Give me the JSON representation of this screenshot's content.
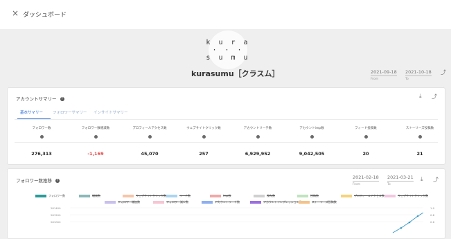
{
  "header": {
    "close_icon": "close-icon",
    "close_glyph": "×",
    "title": "ダッシュボード"
  },
  "profile": {
    "logo_text": "k u r a\n· · ·\ns u m u",
    "name": "kurasumu［クラスム］",
    "date_from": "2021-09-18",
    "date_from_label": "From",
    "date_to": "2021-10-18",
    "date_to_label": "To"
  },
  "summary": {
    "title": "アカウントサマリー",
    "tabs": [
      "基本サマリー",
      "フォロワーサマリー",
      "インサイトサマリー"
    ],
    "active_tab": 0,
    "columns": [
      {
        "label": "フォロワー数",
        "value": "276,313",
        "negative": false
      },
      {
        "label": "フォロワー数増減数",
        "value": "-1,169",
        "negative": true
      },
      {
        "label": "プロフィールアクセス数",
        "value": "45,070",
        "negative": false
      },
      {
        "label": "ウェブサイトクリック数",
        "value": "257",
        "negative": false
      },
      {
        "label": "アカウントリーチ数",
        "value": "6,929,952",
        "negative": false
      },
      {
        "label": "アカウントimp数",
        "value": "9,042,505",
        "negative": false
      },
      {
        "label": "フィード投稿数",
        "value": "20",
        "negative": false
      },
      {
        "label": "ストーリーズ投稿数",
        "value": "21",
        "negative": false
      }
    ]
  },
  "followers_chart": {
    "title": "フォロワー数推移",
    "date_from": "2021-02-18",
    "date_from_label": "From",
    "date_to": "2021-03-21",
    "date_to_label": "To",
    "legend": [
      {
        "label": "フォロワー数",
        "color": "#2a9a9a",
        "strike": false
      },
      {
        "label": "増減数",
        "color": "#8ab8b8",
        "strike": true
      },
      {
        "label": "ウェブサイトクリック数",
        "color": "#f6c6a8",
        "strike": true
      },
      {
        "label": "リーチ数",
        "color": "#a9d4ef",
        "strike": true
      },
      {
        "label": "imp数",
        "color": "#f0a8a8",
        "strike": true
      },
      {
        "label": "保存数",
        "color": "#cfcfcf",
        "strike": true
      },
      {
        "label": "投稿数",
        "color": "#bfe3bf",
        "strike": true
      },
      {
        "label": "プロフィールアクセス数",
        "color": "#f6d27a",
        "strike": true
      },
      {
        "label": "ウェブサイトクリック数",
        "color": "#f3c7e0",
        "strike": true
      },
      {
        "label": "フォロワー増加数",
        "color": "#c9c0ee",
        "strike": true
      },
      {
        "label": "フォロワー減少数",
        "color": "#f7c6d4",
        "strike": true
      },
      {
        "label": "アカウントリーチ数",
        "color": "#8fb0f0",
        "strike": true
      },
      {
        "label": "アカウントインプレッション数",
        "color": "#9b6fe0",
        "strike": true
      },
      {
        "label": "ストーリーズ投稿数",
        "color": "#f4c38a",
        "strike": true
      }
    ],
    "y_ticks_left": [
      "281400",
      "281200",
      "281000"
    ],
    "y_ticks_right": [
      "1.0",
      "0.8",
      "0.6"
    ]
  },
  "colors": {
    "accent": "#2f6ed8",
    "negative": "#e04545",
    "line": "#3a9ac9"
  }
}
